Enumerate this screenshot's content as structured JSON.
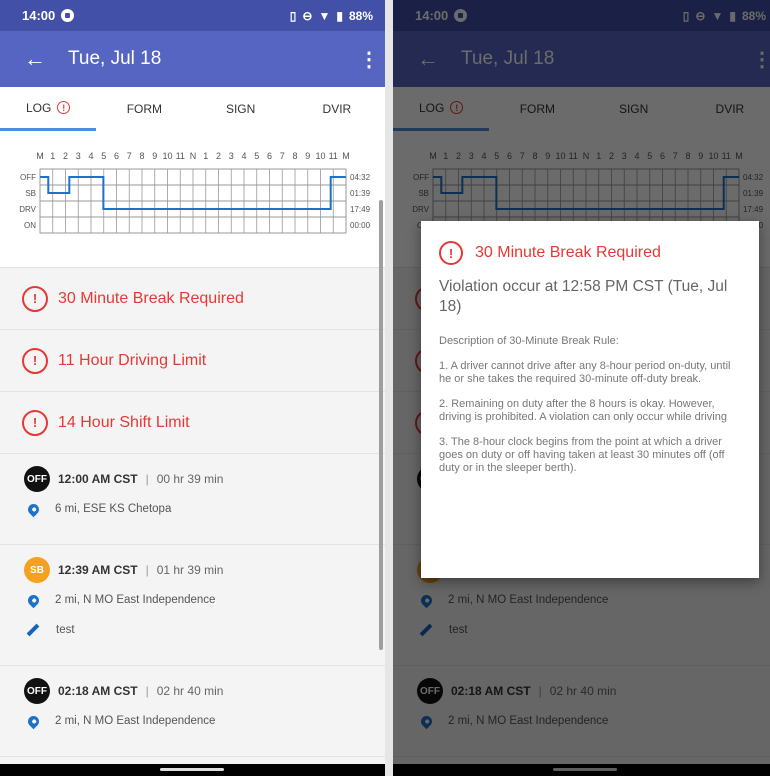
{
  "status": {
    "time": "14:00",
    "battery": "88%"
  },
  "appbar": {
    "title": "Tue, Jul 18"
  },
  "tabs": [
    {
      "label": "LOG"
    },
    {
      "label": "FORM"
    },
    {
      "label": "SIGN"
    },
    {
      "label": "DVIR"
    }
  ],
  "chart_data": {
    "type": "line",
    "title": "",
    "hour_labels": [
      "M",
      "1",
      "2",
      "3",
      "4",
      "5",
      "6",
      "7",
      "8",
      "9",
      "10",
      "11",
      "N",
      "1",
      "2",
      "3",
      "4",
      "5",
      "6",
      "7",
      "8",
      "9",
      "10",
      "11",
      "M"
    ],
    "rows": [
      "OFF",
      "SB",
      "DRV",
      "ON"
    ],
    "totals": [
      "04:32",
      "01:39",
      "17:49",
      "00:00"
    ],
    "segments": [
      {
        "status": "OFF",
        "start": 0,
        "end": 0.65
      },
      {
        "status": "SB",
        "start": 0.65,
        "end": 2.3
      },
      {
        "status": "OFF",
        "start": 2.3,
        "end": 4.97
      },
      {
        "status": "DRV",
        "start": 4.97,
        "end": 22.8
      },
      {
        "status": "OFF",
        "start": 22.8,
        "end": 24
      }
    ],
    "colors": {
      "line": "#1e73c8",
      "grid": "#999999"
    }
  },
  "violations": [
    {
      "label": "30 Minute Break Required"
    },
    {
      "label": "11 Hour Driving Limit"
    },
    {
      "label": "14 Hour Shift Limit"
    }
  ],
  "events": [
    {
      "badge": "OFF",
      "time": "12:00 AM CST",
      "duration": "00 hr 39 min",
      "location": "6 mi, ESE KS Chetopa",
      "note": ""
    },
    {
      "badge": "SB",
      "time": "12:39 AM CST",
      "duration": "01 hr 39 min",
      "location": "2 mi, N MO East Independence",
      "note": "test"
    },
    {
      "badge": "OFF",
      "time": "02:18 AM CST",
      "duration": "02 hr 40 min",
      "location": "2 mi, N MO East Independence",
      "note": ""
    }
  ],
  "separator": "|",
  "dialog": {
    "title": "30 Minute Break Required",
    "subtitle": "Violation occur at 12:58 PM CST (Tue, Jul 18)",
    "description_title": "Description of 30-Minute Break Rule:",
    "rules": [
      "1. A driver cannot drive after any 8-hour period on-duty, until he or she takes the required 30-minute off-duty break.",
      "2. Remaining on duty after the 8 hours is okay. However, driving is prohibited. A violation can only occur while driving",
      "3. The 8-hour clock begins from the point at which a driver goes on duty or off having taken at least 30 minutes off (off duty or in the sleeper berth)."
    ]
  },
  "icons": {
    "back": "arrow-left-icon",
    "menu": "more-vert-icon",
    "warning": "warning-circle-icon",
    "location": "location-pin-icon",
    "note": "pencil-icon"
  }
}
